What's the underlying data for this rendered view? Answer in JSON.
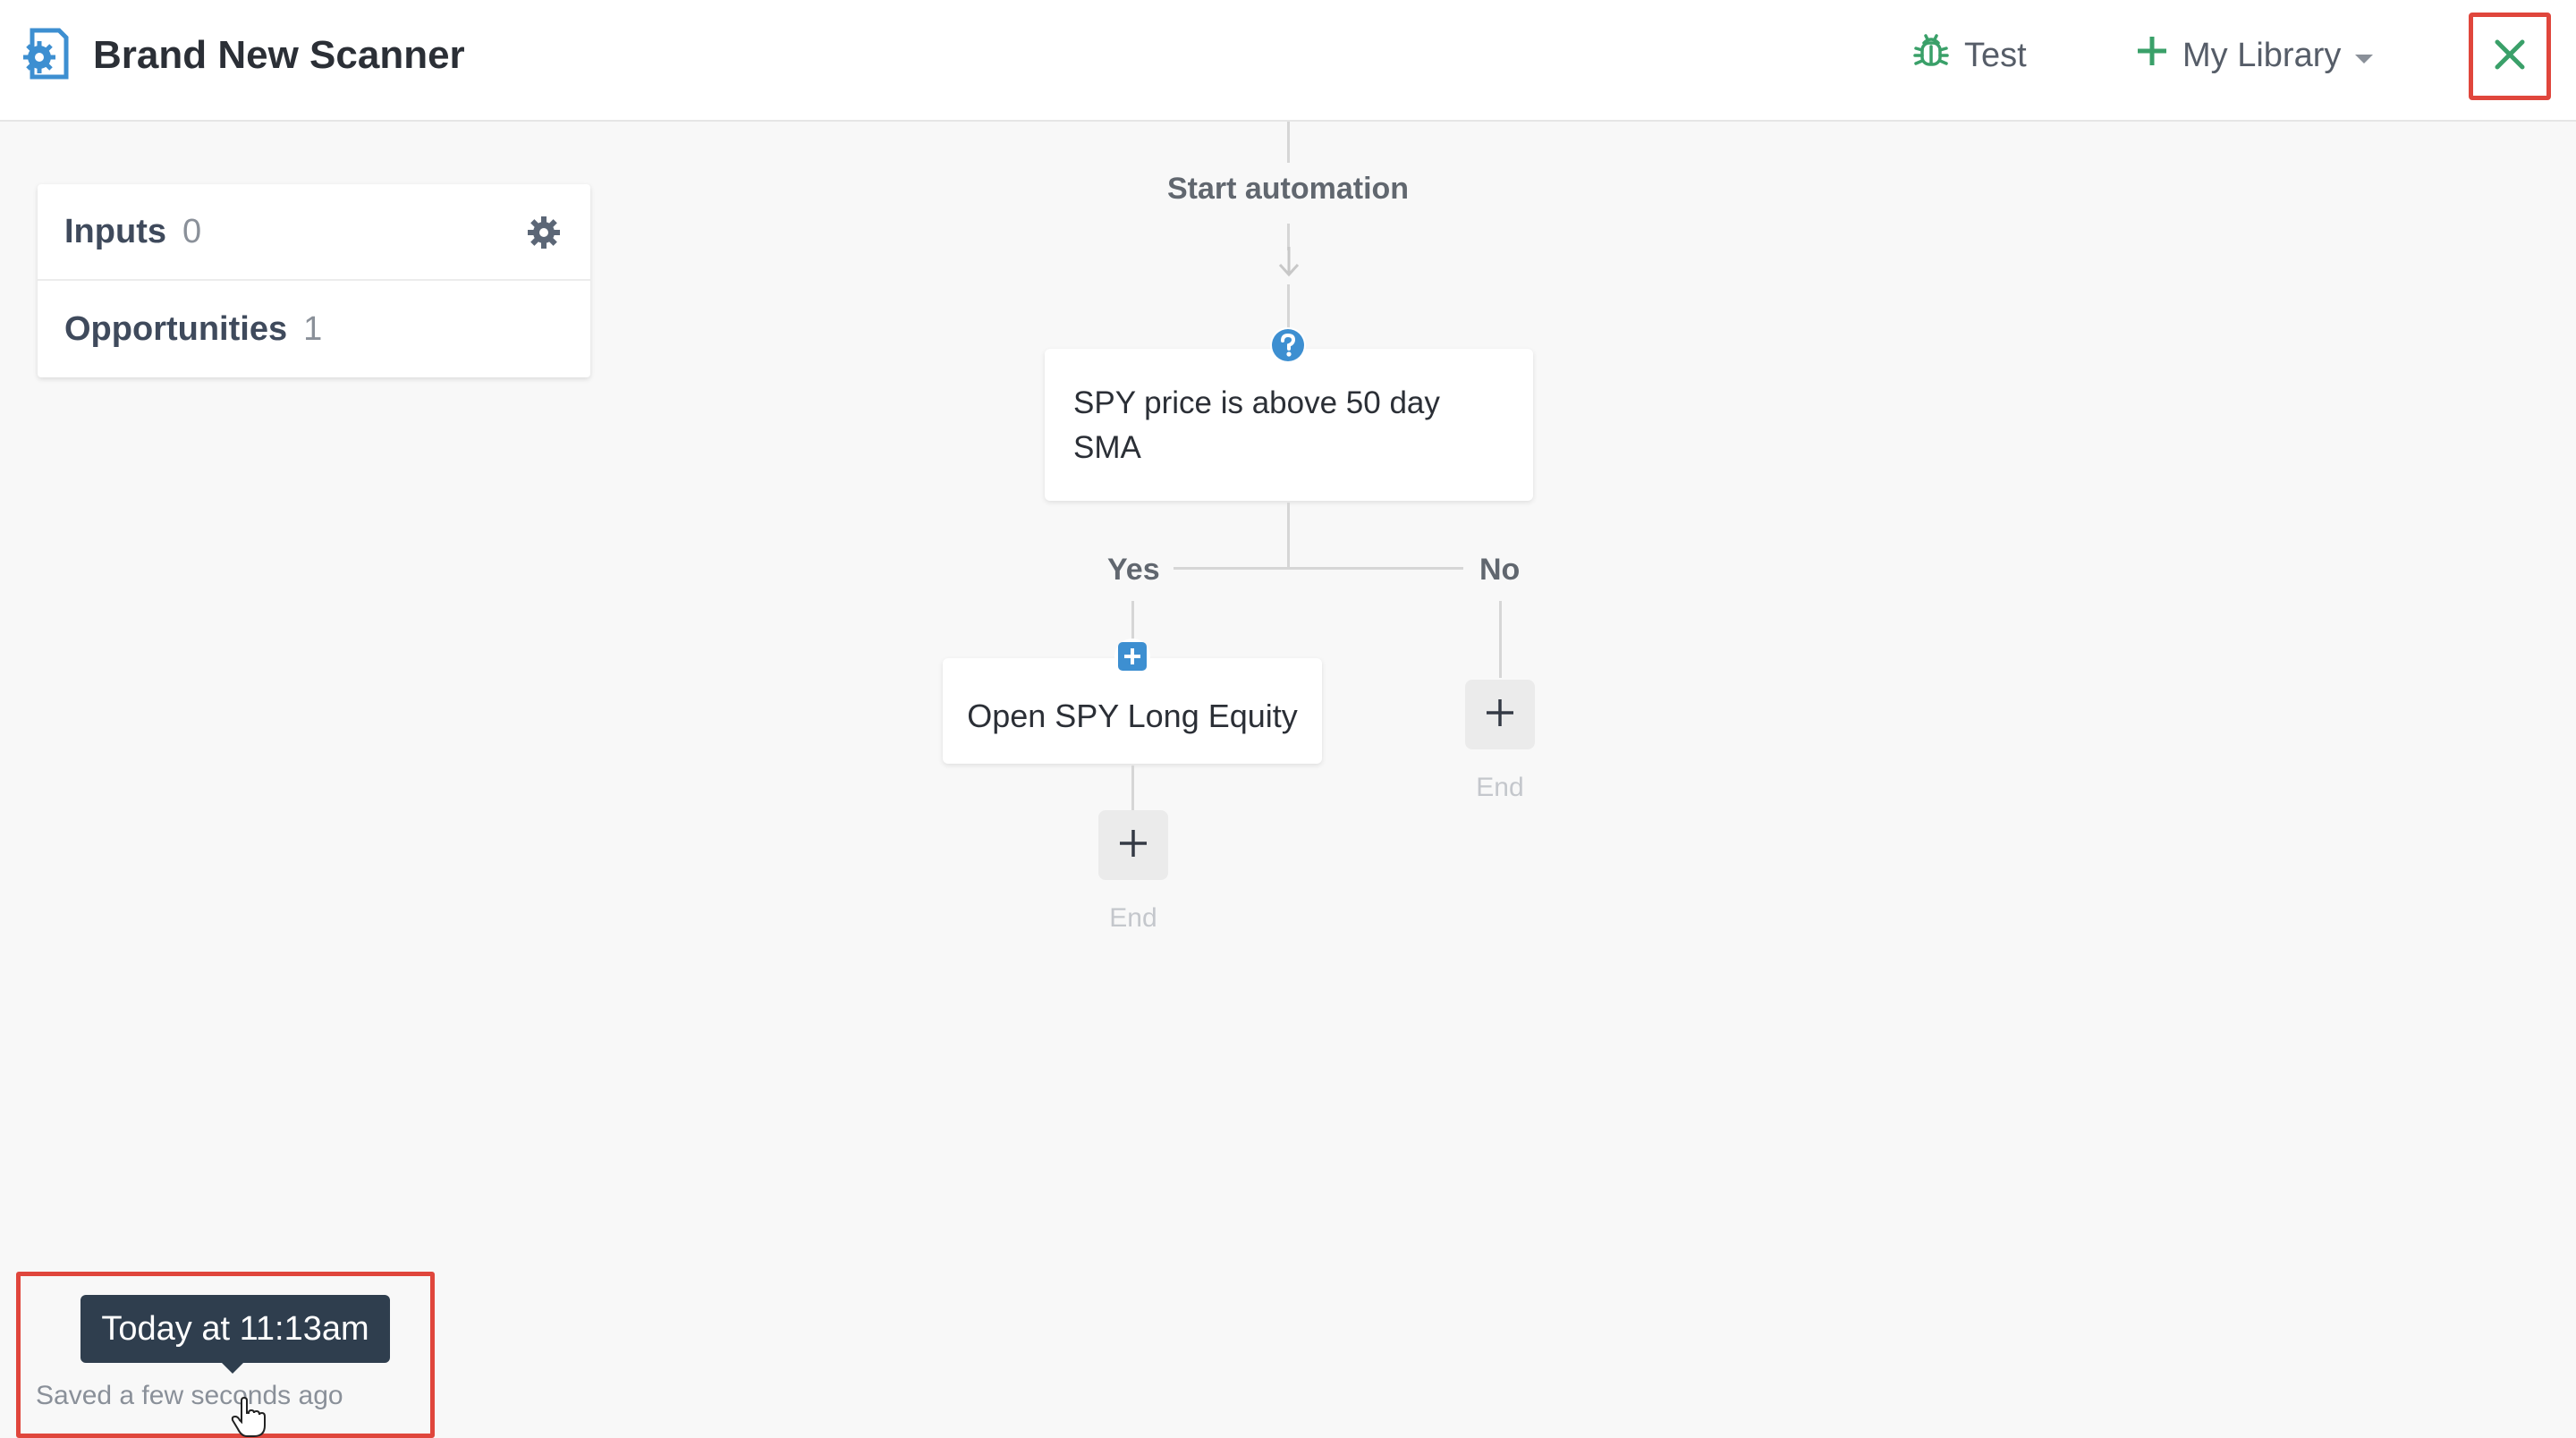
{
  "header": {
    "title": "Brand New Scanner",
    "app_icon": "scanner-gear-icon",
    "test_label": "Test",
    "library_label": "My Library",
    "close_icon": "close-x-icon"
  },
  "panel": {
    "inputs_label": "Inputs",
    "inputs_count": "0",
    "opportunities_label": "Opportunities",
    "opportunities_count": "1"
  },
  "flow": {
    "start_label": "Start automation",
    "condition_text": "SPY price is above 50 day SMA",
    "yes_label": "Yes",
    "no_label": "No",
    "action_text": "Open SPY Long Equity",
    "end_label": "End"
  },
  "status": {
    "tooltip": "Today at 11:13am",
    "saved": "Saved a few seconds ago"
  },
  "colors": {
    "accent_green": "#3aa069",
    "accent_blue": "#3d8fd1",
    "highlight_red": "#e0463c",
    "tooltip_bg": "#2f3e4e"
  }
}
